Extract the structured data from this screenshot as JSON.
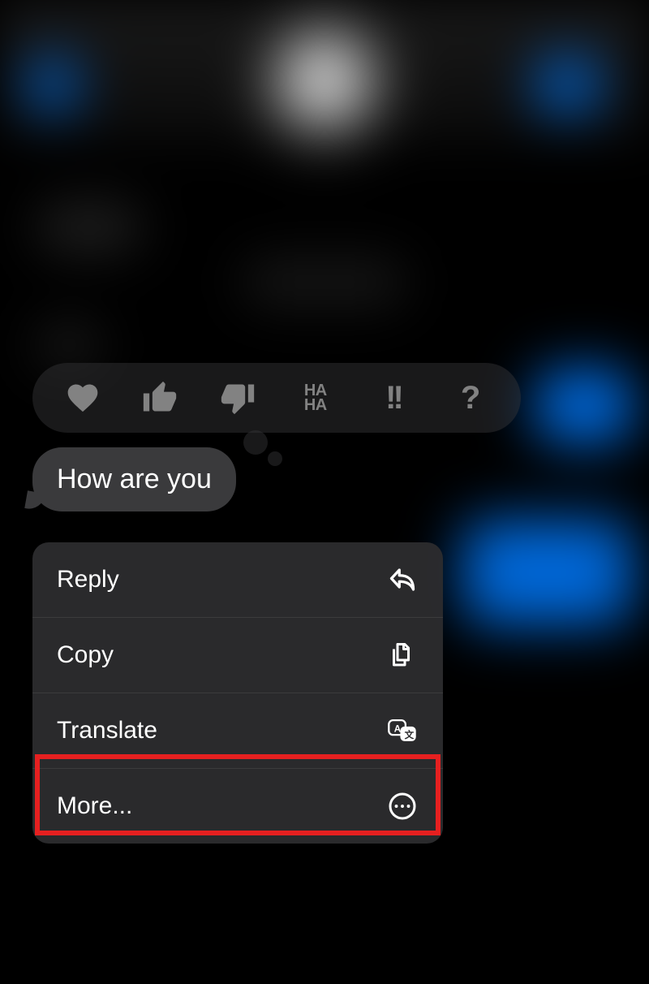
{
  "message": {
    "text": "How are you"
  },
  "reactions": {
    "heart": "heart",
    "thumbs_up": "thumbs-up",
    "thumbs_down": "thumbs-down",
    "haha_line1": "HA",
    "haha_line2": "HA",
    "double_exclamation": "!!",
    "question": "?"
  },
  "menu": {
    "items": [
      {
        "label": "Reply",
        "icon": "reply"
      },
      {
        "label": "Copy",
        "icon": "copy"
      },
      {
        "label": "Translate",
        "icon": "translate"
      },
      {
        "label": "More...",
        "icon": "more"
      }
    ]
  }
}
